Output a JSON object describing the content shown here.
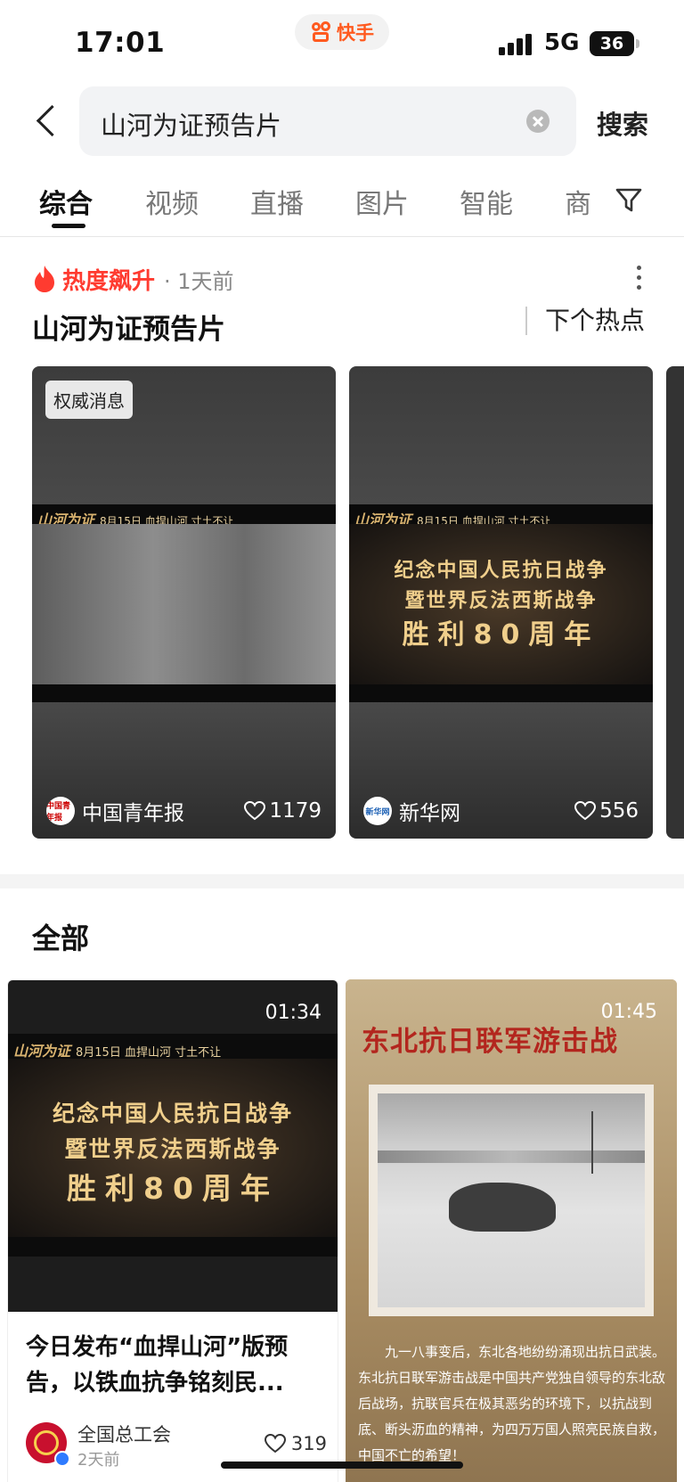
{
  "status_bar": {
    "time": "17:01",
    "app_name": "快手",
    "network": "5G",
    "battery": "36"
  },
  "search": {
    "query": "山河为证预告片",
    "submit_label": "搜索"
  },
  "tabs": [
    {
      "label": "综合",
      "active": true
    },
    {
      "label": "视频",
      "active": false
    },
    {
      "label": "直播",
      "active": false
    },
    {
      "label": "图片",
      "active": false
    },
    {
      "label": "智能",
      "active": false
    },
    {
      "label": "商",
      "active": false
    }
  ],
  "hot": {
    "badge": "热度飙升",
    "time": "· 1天前",
    "title": "山河为证预告片",
    "next_label": "下个热点",
    "cards": [
      {
        "badge": "权威消息",
        "banner_title": "山河为证",
        "banner_text": "8月15日 血捍山河 寸土不让",
        "author": "中国青年报",
        "avatar_text": "中国青年报",
        "likes": "1179"
      },
      {
        "banner_title": "山河为证",
        "banner_text": "8月15日 血捍山河 寸土不让",
        "poster_lines": [
          "纪念中国人民抗日战争",
          "暨世界反法西斯战争",
          "胜利80周年"
        ],
        "author": "新华网",
        "avatar_text": "新华网",
        "likes": "556"
      }
    ]
  },
  "all_section": {
    "title": "全部",
    "cards": [
      {
        "duration": "01:34",
        "banner_title": "山河为证",
        "banner_text": "8月15日 血捍山河 寸土不让",
        "poster_lines": [
          "纪念中国人民抗日战争",
          "暨世界反法西斯战争",
          "胜利80周年"
        ],
        "desc": "今日发布“血捍山河”版预告，以铁血抗争铭刻民...",
        "author": "全国总工会",
        "time": "2天前",
        "likes": "319"
      },
      {
        "duration": "01:45",
        "poster_title": "东北抗日联军游击战",
        "poster_text": "九一八事变后，东北各地纷纷涌现出抗日武装。东北抗日联军游击战是中国共产党独自领导的东北敌后战场，抗联官兵在极其恶劣的环境下，以抗战到底、断头沥血的精神，为四万万国人照亮民族自救，中国不亡的希望！"
      }
    ]
  },
  "colors": {
    "accent_hot": "#ff3b30",
    "brand_orange": "#ff5a1f",
    "verified_blue": "#2e7bff"
  }
}
